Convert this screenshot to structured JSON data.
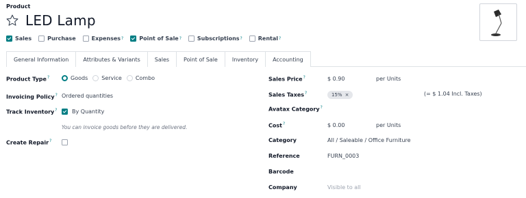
{
  "header": {
    "breadcrumb": "Product",
    "title": "LED Lamp"
  },
  "product_image": {
    "alt": "lamp-image"
  },
  "checkboxes": [
    {
      "label": "Sales",
      "checked": true,
      "help": ""
    },
    {
      "label": "Purchase",
      "checked": false,
      "help": ""
    },
    {
      "label": "Expenses",
      "checked": false,
      "help": "?"
    },
    {
      "label": "Point of Sale",
      "checked": true,
      "help": "?"
    },
    {
      "label": "Subscriptions",
      "checked": false,
      "help": "?"
    },
    {
      "label": "Rental",
      "checked": false,
      "help": "?"
    }
  ],
  "tabs": [
    {
      "label": "General Information",
      "active": true
    },
    {
      "label": "Attributes & Variants",
      "active": false
    },
    {
      "label": "Sales",
      "active": false
    },
    {
      "label": "Point of Sale",
      "active": false
    },
    {
      "label": "Inventory",
      "active": false
    },
    {
      "label": "Accounting",
      "active": false
    }
  ],
  "left": {
    "product_type_label": "Product Type",
    "product_type_options": [
      "Goods",
      "Service",
      "Combo"
    ],
    "product_type_selected": "Goods",
    "invoicing_policy_label": "Invoicing Policy",
    "invoicing_policy_value": "Ordered quantities",
    "track_inventory_label": "Track Inventory",
    "track_inventory_value": "By Quantity",
    "invoice_hint": "You can invoice goods before they are delivered.",
    "create_repair_label": "Create Repair"
  },
  "right": {
    "sales_price_label": "Sales Price",
    "sales_price_value": "$ 0.90",
    "sales_price_unit": "per Units",
    "sales_taxes_label": "Sales Taxes",
    "sales_taxes_tag": "15%",
    "sales_taxes_incl": "(= $ 1.04 Incl. Taxes)",
    "avatax_label": "Avatax Category",
    "cost_label": "Cost",
    "cost_value": "$ 0.00",
    "cost_unit": "per Units",
    "category_label": "Category",
    "category_value": "All / Saleable / Office Furniture",
    "reference_label": "Reference",
    "reference_value": "FURN_0003",
    "barcode_label": "Barcode",
    "company_label": "Company",
    "company_placeholder": "Visible to all"
  },
  "colors": {
    "accent": "#017e84"
  }
}
